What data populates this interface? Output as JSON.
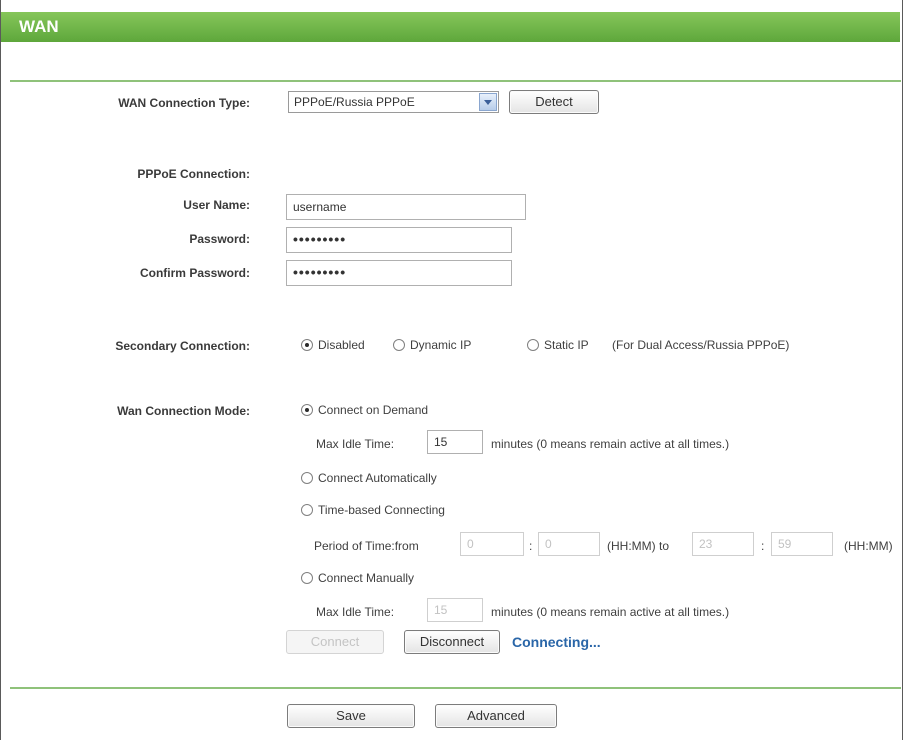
{
  "header": {
    "title": "WAN"
  },
  "wan_type": {
    "label": "WAN Connection Type:",
    "selected": "PPPoE/Russia PPPoE",
    "detect_label": "Detect"
  },
  "pppoe": {
    "section_label": "PPPoE Connection:",
    "username_label": "User Name:",
    "username_value": "username",
    "password_label": "Password:",
    "password_value": "•••••••••",
    "confirm_label": "Confirm Password:",
    "confirm_value": "•••••••••"
  },
  "secondary": {
    "label": "Secondary Connection:",
    "options": [
      "Disabled",
      "Dynamic IP",
      "Static IP"
    ],
    "selected": "Disabled",
    "note": "(For Dual Access/Russia PPPoE)"
  },
  "mode": {
    "label": "Wan Connection Mode:",
    "selected": "Connect on Demand",
    "on_demand": {
      "label": "Connect on Demand",
      "idle_label": "Max Idle Time:",
      "idle_value": "15",
      "idle_note": "minutes (0 means remain active at all times.)"
    },
    "automatically": {
      "label": "Connect Automatically"
    },
    "time_based": {
      "label": "Time-based Connecting",
      "period_label": "Period of Time:from",
      "from_hh": "0",
      "from_mm": "0",
      "to_label": "(HH:MM) to",
      "to_hh": "23",
      "to_mm": "59",
      "end_label": "(HH:MM)"
    },
    "manually": {
      "label": "Connect Manually",
      "idle_label": "Max Idle Time:",
      "idle_value": "15",
      "idle_note": "minutes (0 means remain active at all times.)"
    }
  },
  "actions": {
    "connect": "Connect",
    "disconnect": "Disconnect",
    "status": "Connecting..."
  },
  "footer": {
    "save": "Save",
    "advanced": "Advanced"
  }
}
